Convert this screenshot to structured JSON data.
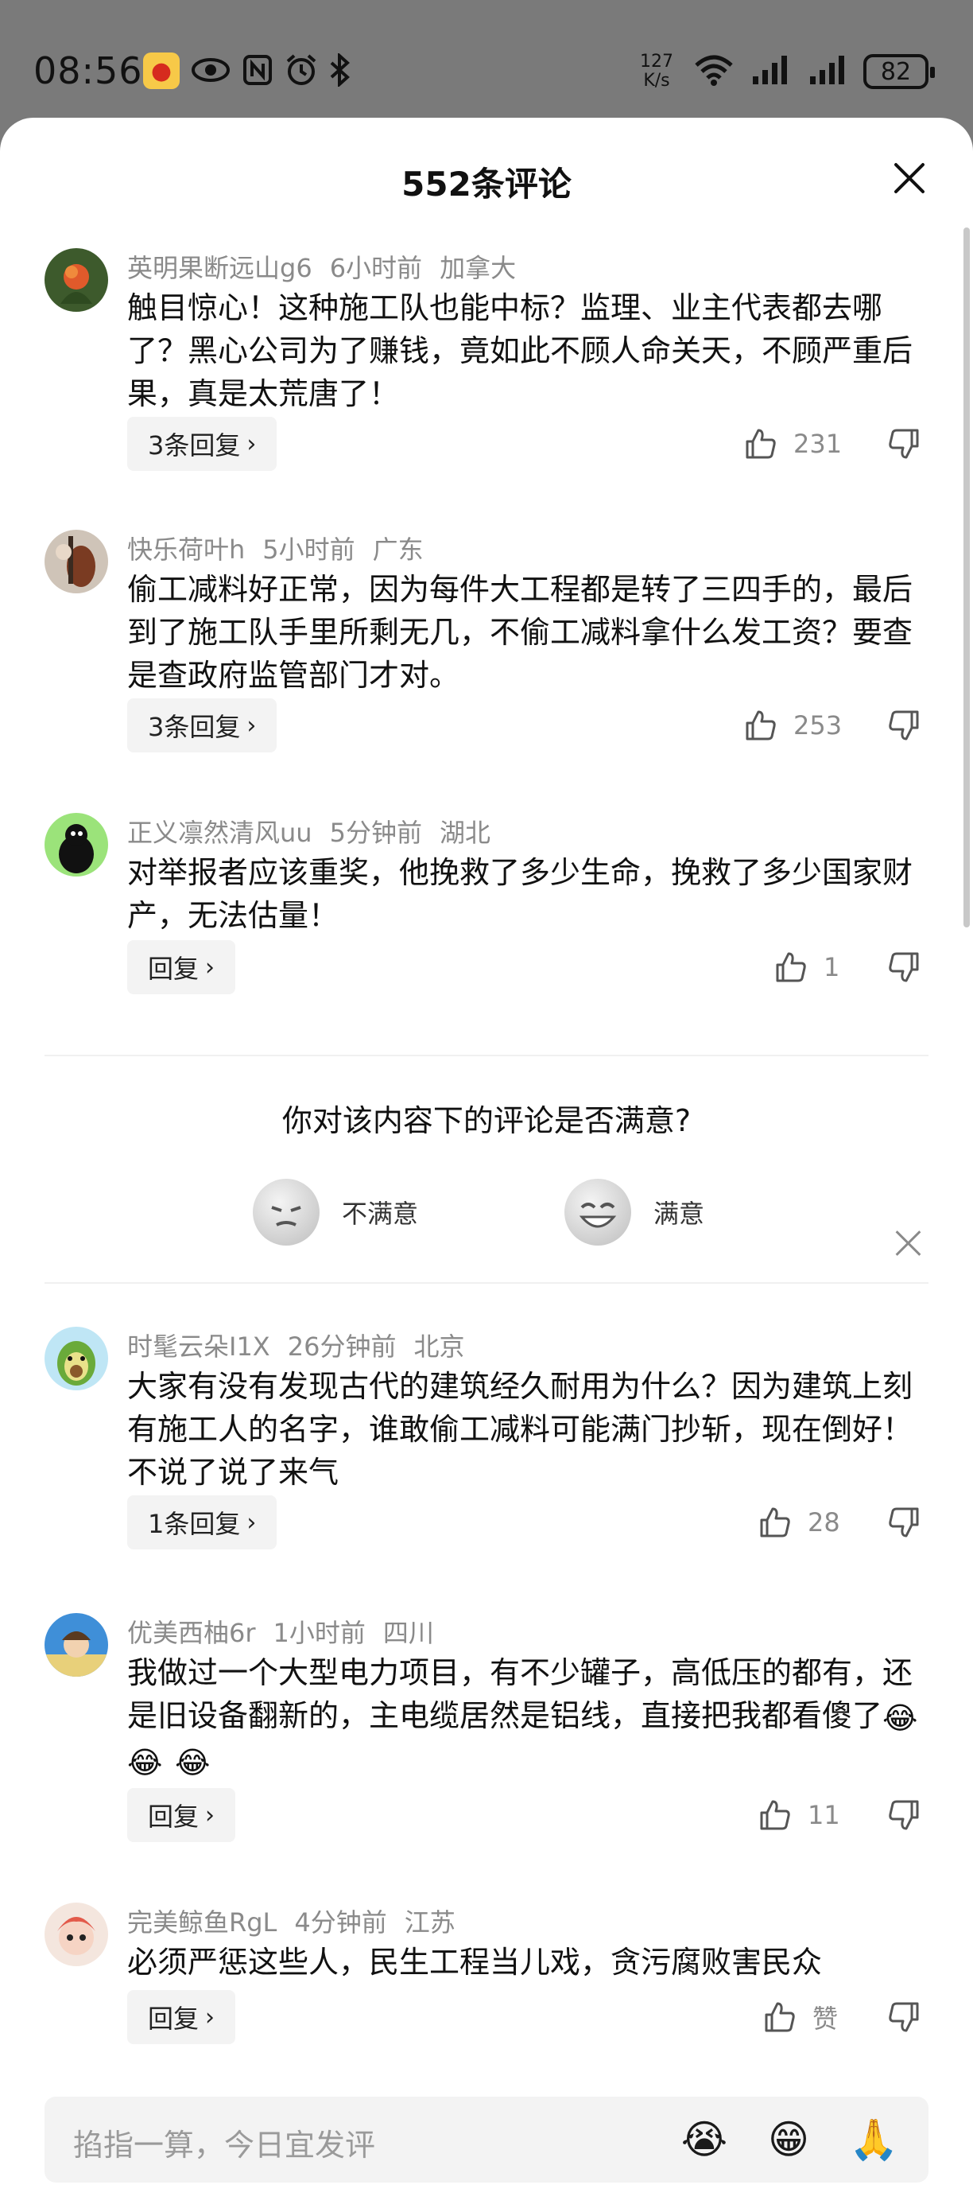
{
  "status_bar": {
    "time": "08:56",
    "net_speed_value": "127",
    "net_speed_unit": "K/s",
    "battery": "82",
    "icons": [
      "weibo-icon",
      "eye-icon",
      "nfc-icon",
      "alarm-icon",
      "bluetooth-icon",
      "wifi-icon",
      "signal-icon",
      "signal-icon",
      "battery-icon"
    ]
  },
  "sheet": {
    "title": "552条评论"
  },
  "comments": [
    {
      "user": "英明果断远山g6",
      "time": "6小时前",
      "location": "加拿大",
      "text": "触目惊心！这种施工队也能中标？监理、业主代表都去哪了？黑心公司为了赚钱，竟如此不顾人命关天，不顾严重后果，真是太荒唐了！",
      "reply_label": "3条回复",
      "likes": "231"
    },
    {
      "user": "快乐荷叶h",
      "time": "5小时前",
      "location": "广东",
      "text": "偷工减料好正常，因为每件大工程都是转了三四手的，最后到了施工队手里所剩无几，不偷工减料拿什么发工资？要查是查政府监管部门才对。",
      "reply_label": "3条回复",
      "likes": "253"
    },
    {
      "user": "正义凛然清风uu",
      "time": "5分钟前",
      "location": "湖北",
      "text": "对举报者应该重奖，他挽救了多少生命，挽救了多少国家财产，无法估量！",
      "reply_label": "回复",
      "likes": "1"
    },
    {
      "user": "时髦云朵I1X",
      "time": "26分钟前",
      "location": "北京",
      "text": "大家有没有发现古代的建筑经久耐用为什么？因为建筑上刻有施工人的名字，谁敢偷工减料可能满门抄斩，现在倒好！不说了说了来气",
      "reply_label": "1条回复",
      "likes": "28"
    },
    {
      "user": "优美西柚6r",
      "time": "1小时前",
      "location": "四川",
      "text": "我做过一个大型电力项目，有不少罐子，高低压的都有，还是旧设备翻新的，主电缆居然是铝线，直接把我都看傻了",
      "emoji": [
        "😂",
        "😂",
        "😂"
      ],
      "reply_label": "回复",
      "likes": "11"
    },
    {
      "user": "完美鲸鱼RgL",
      "time": "4分钟前",
      "location": "江苏",
      "text": "必须严惩这些人，民生工程当儿戏，贪污腐败害民众",
      "reply_label": "回复",
      "likes": "赞"
    }
  ],
  "survey": {
    "question": "你对该内容下的评论是否满意?",
    "option_bad": "不满意",
    "option_good": "满意"
  },
  "input": {
    "placeholder": "掐指一算，今日宜发评",
    "emojis": [
      "😭",
      "😁",
      "🙏"
    ]
  },
  "colors": {
    "accent_gray": "#8a8a8a",
    "chip_bg": "#f3f3f3",
    "statusbar_bg": "#7a7a7a"
  }
}
